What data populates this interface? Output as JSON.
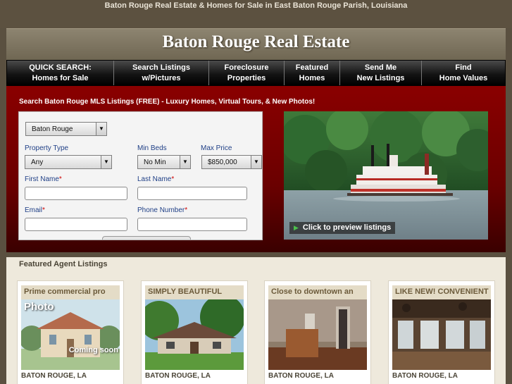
{
  "page": {
    "topline": "Baton Rouge Real Estate & Homes for Sale in East Baton Rouge Parish, Louisiana",
    "site_title": "Baton Rouge Real Estate"
  },
  "nav": [
    {
      "line1": "QUICK SEARCH:",
      "line2": "Homes for Sale"
    },
    {
      "line1": "Search Listings",
      "line2": "w/Pictures"
    },
    {
      "line1": "Foreclosure",
      "line2": "Properties"
    },
    {
      "line1": "Featured",
      "line2": "Homes"
    },
    {
      "line1": "Send Me",
      "line2": "New Listings"
    },
    {
      "line1": "Find",
      "line2": "Home Values"
    }
  ],
  "search": {
    "heading": "Search Baton Rouge MLS Listings (FREE) - Luxury Homes, Virtual Tours, & New Photos!",
    "city_value": "Baton Rouge",
    "property_type_label": "Property Type",
    "property_type_value": "Any",
    "min_beds_label": "Min Beds",
    "min_beds_value": "No Min",
    "max_price_label": "Max Price",
    "max_price_value": "$850,000",
    "first_name_label": "First Name",
    "last_name_label": "Last Name",
    "email_label": "Email",
    "phone_label": "Phone Number",
    "required_mark": "*"
  },
  "preview": {
    "label": "Click to preview listings"
  },
  "featured": {
    "title": "Featured Agent Listings",
    "cards": [
      {
        "title": "Prime commercial pro",
        "city": "BATON ROUGE, LA",
        "overlay_top": "Photo",
        "overlay_bottom": "Coming soon"
      },
      {
        "title": "SIMPLY BEAUTIFUL",
        "city": "BATON ROUGE, LA"
      },
      {
        "title": "Close to downtown an",
        "city": "BATON ROUGE, LA"
      },
      {
        "title": "LIKE NEW! CONVENIENT",
        "city": "BATON ROUGE, LA"
      }
    ]
  },
  "colors": {
    "brand_dark": "#5c5140",
    "nav_black": "#141414",
    "hero_red": "#8a0000",
    "label_blue": "#1f3f86",
    "required_red": "#cc0000",
    "card_title_bg": "#e4dcc7"
  }
}
